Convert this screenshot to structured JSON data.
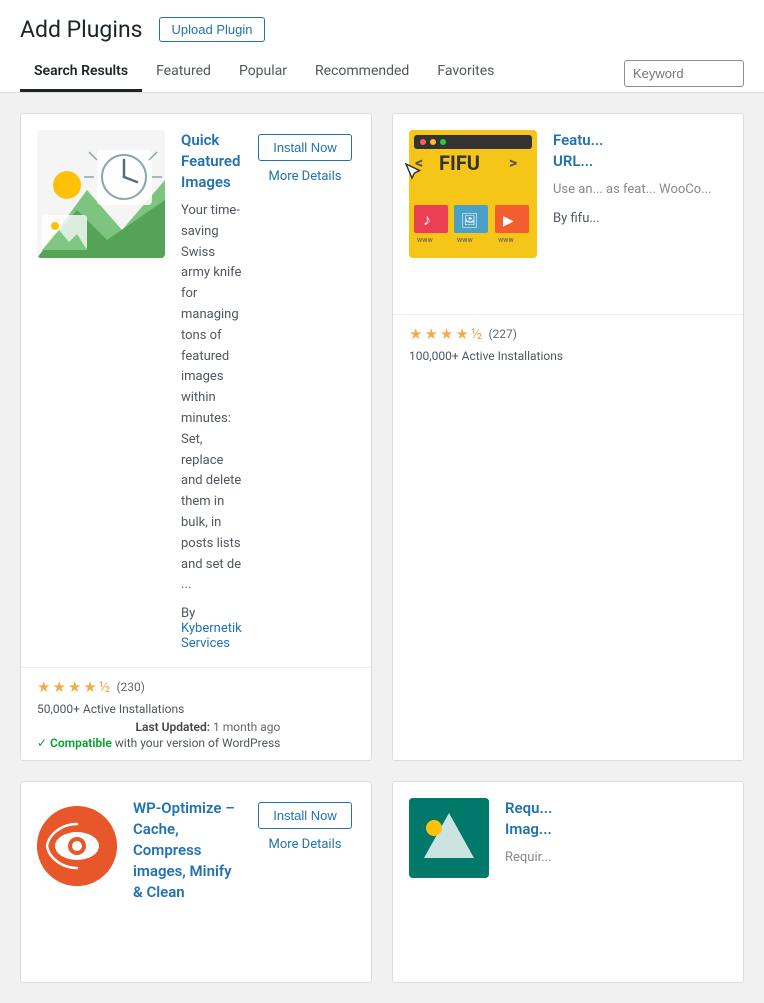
{
  "page": {
    "title": "Add Plugins",
    "upload_button": "Upload Plugin"
  },
  "nav": {
    "tabs": [
      {
        "id": "search-results",
        "label": "Search Results",
        "active": true
      },
      {
        "id": "featured",
        "label": "Featured",
        "active": false
      },
      {
        "id": "popular",
        "label": "Popular",
        "active": false
      },
      {
        "id": "recommended",
        "label": "Recommended",
        "active": false
      },
      {
        "id": "favorites",
        "label": "Favorites",
        "active": false
      }
    ],
    "keyword_placeholder": "Keyword"
  },
  "plugins": [
    {
      "id": "quick-featured-images",
      "name": "Quick Featured Images",
      "description": "Your time-saving Swiss army knife for managing tons of featured images within minutes: Set, replace and delete them in bulk, in posts lists and set de ...",
      "author_label": "By",
      "author_name": "Kybernetik Services",
      "install_label": "Install Now",
      "details_label": "More Details",
      "stars": 4.5,
      "rating_count": "(230)",
      "installations": "50,000+ Active Installations",
      "last_updated_label": "Last Updated:",
      "last_updated_value": "1 month ago",
      "compatible_check": "✓",
      "compatible_text": "Compatible",
      "compatible_suffix": "with your version of WordPress"
    },
    {
      "id": "fifu",
      "name": "Featu... URL...",
      "description_truncated": "Use an... as feat... WooCo...",
      "author_label": "By fifu...",
      "stars": 4.5,
      "rating_count": "(227)",
      "installations": "100,000+ Active Installations"
    }
  ],
  "plugins_row2": [
    {
      "id": "wp-optimize",
      "name": "WP-Optimize – Cache, Compress images, Minify & Clean",
      "install_label": "Install Now",
      "details_label": "More Details"
    },
    {
      "id": "requ-imag",
      "name": "Requ... Imag...",
      "description_truncated": "Requir..."
    }
  ]
}
